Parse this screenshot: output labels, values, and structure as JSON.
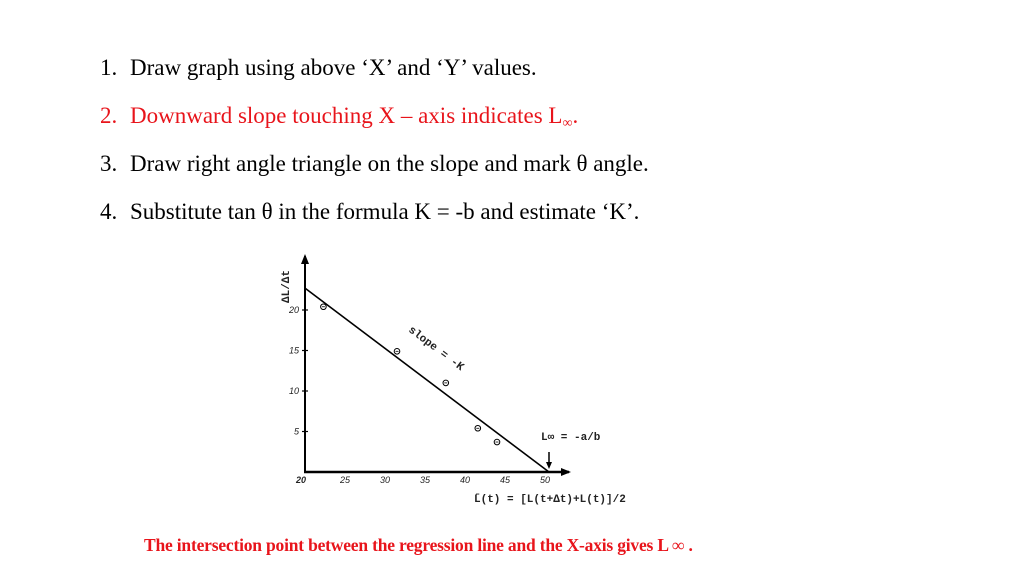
{
  "instructions": [
    {
      "number": "1.",
      "text": "Draw graph using above ‘X’ and ‘Y’ values.",
      "color": "#000000"
    },
    {
      "number": "2.",
      "text": "Downward slope touching X – axis indicates L",
      "subscript": "∞",
      "suffix": ".",
      "color": "#e8141b"
    },
    {
      "number": "3.",
      "text": "Draw right angle triangle on the slope and mark θ angle.",
      "color": "#000000"
    },
    {
      "number": "4.",
      "text": "Substitute tan θ in the formula K = -b and estimate ‘K’.",
      "color": "#000000"
    }
  ],
  "caption": "The intersection point between the regression line and the X-axis gives L ∞ .",
  "chart_data": {
    "type": "scatter",
    "title": "",
    "xlabel": "L̄(t) = [L(t+Δt)+L(t)]/2",
    "ylabel": "ΔL/Δt",
    "xlim": [
      20,
      52
    ],
    "ylim": [
      0,
      25
    ],
    "x_ticks": [
      20,
      25,
      30,
      35,
      40,
      45,
      50
    ],
    "y_ticks": [
      5,
      10,
      15,
      20
    ],
    "grid": false,
    "points": [
      {
        "x": 22.3,
        "y": 20.4
      },
      {
        "x": 31.5,
        "y": 14.9
      },
      {
        "x": 37.6,
        "y": 11.0
      },
      {
        "x": 41.6,
        "y": 5.4
      },
      {
        "x": 44.0,
        "y": 3.7
      }
    ],
    "regression_line": {
      "x_start": 20,
      "y_start": 22.7,
      "x_end": 50.5,
      "y_end": 0
    },
    "annotations": [
      {
        "text": "slope = -K",
        "near": "middle of regression line"
      },
      {
        "text": "L∞ = -a/b",
        "near": "x-intercept",
        "arrow": true
      }
    ]
  }
}
